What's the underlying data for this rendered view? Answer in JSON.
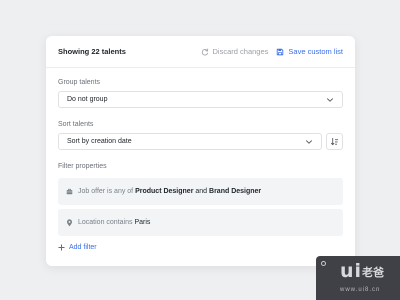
{
  "header": {
    "title": "Showing 22 talents",
    "discard_label": "Discard changes",
    "save_label": "Save custom list"
  },
  "group": {
    "label": "Group talents",
    "value": "Do not group"
  },
  "sort": {
    "label": "Sort talents",
    "value": "Sort by creation date"
  },
  "filters": {
    "label": "Filter properties",
    "job_filter": {
      "prefix": "Job offer is any of",
      "value1": "Product Designer",
      "joiner": "and",
      "value2": "Brand Designer"
    },
    "location_filter": {
      "prefix": "Location contains",
      "value": "Paris"
    },
    "add_label": "Add filter"
  },
  "watermark": {
    "mark": "ui",
    "glyphs": "老爸",
    "domain": "www.ui8.cn"
  },
  "colors": {
    "accent": "#3a6ee8",
    "background": "#eeeff1",
    "card": "#ffffff",
    "filter_row": "#f3f4f6"
  },
  "icons": {
    "discard": "refresh-icon",
    "save": "save-icon",
    "dropdown": "chevron-down-icon",
    "sort_order": "sort-order-icon",
    "job": "briefcase-icon",
    "location": "location-pin-icon",
    "add": "plus-icon"
  }
}
